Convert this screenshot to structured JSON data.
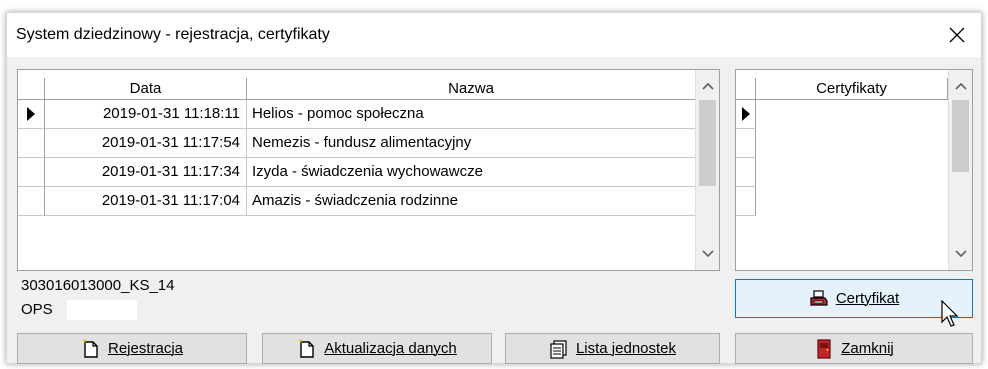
{
  "window": {
    "title": "System dziedzinowy - rejestracja, certyfikaty",
    "close_glyph": "✕"
  },
  "main_grid": {
    "columns": [
      "Data",
      "Nazwa"
    ],
    "rows": [
      {
        "data": "2019-01-31 11:18:11",
        "nazwa": "Helios - pomoc społeczna",
        "current": true
      },
      {
        "data": "2019-01-31 11:17:54",
        "nazwa": "Nemezis - fundusz alimentacyjny",
        "current": false
      },
      {
        "data": "2019-01-31 11:17:34",
        "nazwa": "Izyda - świadczenia wychowawcze",
        "current": false
      },
      {
        "data": "2019-01-31 11:17:04",
        "nazwa": "Amazis - świadczenia rodzinne",
        "current": false
      }
    ]
  },
  "cert_grid": {
    "columns": [
      "Certyfikaty"
    ]
  },
  "info": {
    "unit_code": "303016013000_KS_14",
    "unit_type": "OPS"
  },
  "buttons": {
    "certyfikat": "Certyfikat",
    "rejestracja": "Rejestracja",
    "aktualizacja": "Aktualizacja danych",
    "lista": "Lista jednostek",
    "zamknij": "Zamknij"
  },
  "icons": {
    "certyfikat": "printer-icon",
    "rejestracja": "new-document-icon",
    "aktualizacja": "new-document-icon",
    "lista": "document-list-icon",
    "zamknij": "exit-door-icon"
  },
  "colors": {
    "accent": "#0078d7",
    "door": "#c0262c"
  }
}
